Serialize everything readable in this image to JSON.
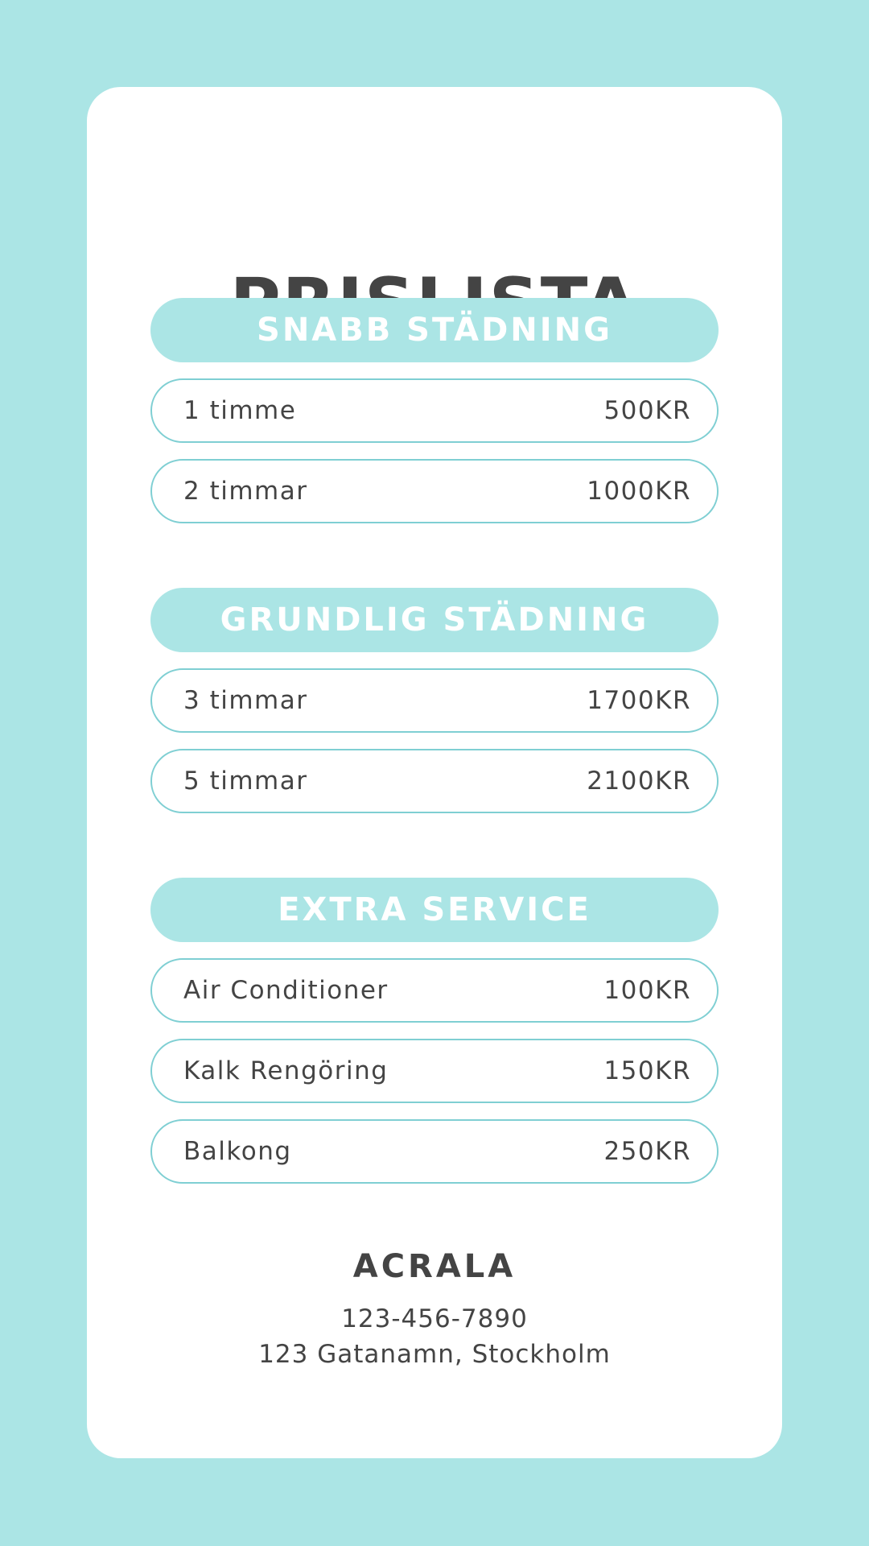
{
  "title": "PRISLISTA",
  "colors": {
    "background": "#abe5e5",
    "card": "#ffffff",
    "text": "#444444",
    "row_border": "#7fcfd3"
  },
  "sections": [
    {
      "heading": "SNABB STÄDNING",
      "items": [
        {
          "label": "1 timme",
          "price": "500KR"
        },
        {
          "label": "2 timmar",
          "price": "1000KR"
        }
      ]
    },
    {
      "heading": "GRUNDLIG STÄDNING",
      "items": [
        {
          "label": "3 timmar",
          "price": "1700KR"
        },
        {
          "label": "5 timmar",
          "price": "2100KR"
        }
      ]
    },
    {
      "heading": "EXTRA SERVICE",
      "items": [
        {
          "label": "Air Conditioner",
          "price": "100KR"
        },
        {
          "label": "Kalk Rengöring",
          "price": "150KR"
        },
        {
          "label": "Balkong",
          "price": "250KR"
        }
      ]
    }
  ],
  "footer": {
    "company": "ACRALA",
    "phone": "123-456-7890",
    "address": "123 Gatanamn, Stockholm"
  }
}
